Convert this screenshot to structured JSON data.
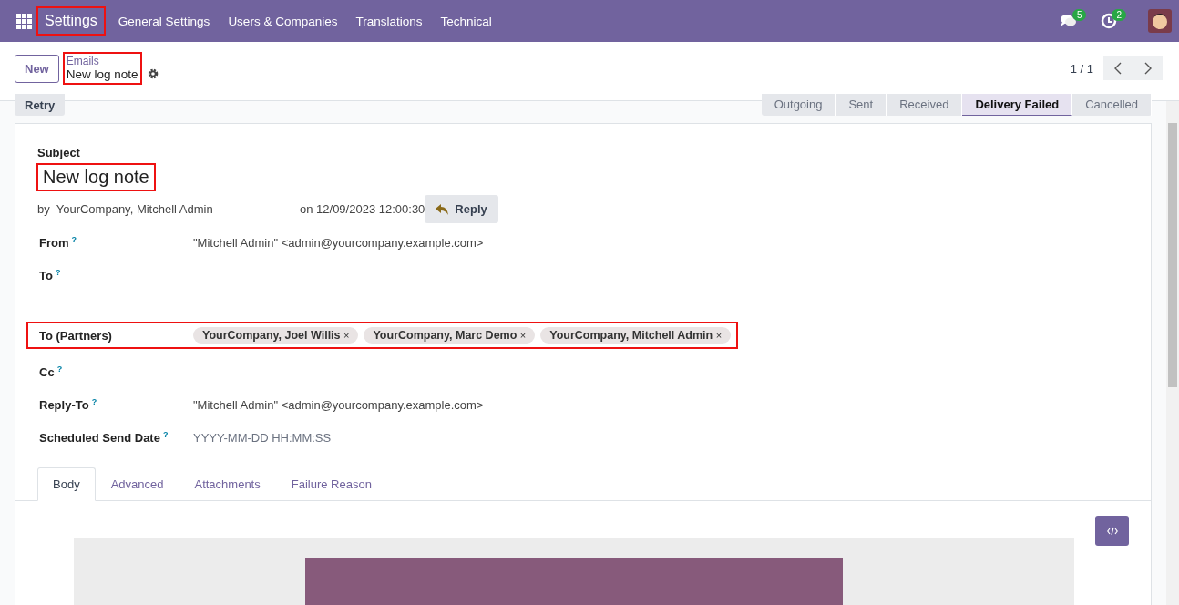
{
  "navbar": {
    "brand": "Settings",
    "brand_highlighted": true,
    "menu": [
      "General Settings",
      "Users & Companies",
      "Translations",
      "Technical"
    ],
    "messages_badge": "5",
    "activities_badge": "2"
  },
  "control_panel": {
    "new_button": "New",
    "breadcrumb_parent": "Emails",
    "breadcrumb_current": "New log note",
    "breadcrumb_highlighted": true,
    "pager": "1 / 1"
  },
  "action_button": "Retry",
  "statusbar": [
    {
      "label": "Outgoing",
      "selected": false
    },
    {
      "label": "Sent",
      "selected": false
    },
    {
      "label": "Received",
      "selected": false
    },
    {
      "label": "Delivery Failed",
      "selected": true
    },
    {
      "label": "Cancelled",
      "selected": false
    }
  ],
  "form": {
    "subject_label": "Subject",
    "subject": "New log note",
    "subject_highlighted": true,
    "author": "by  YourCompany, Mitchell Admin",
    "date": "on 12/09/2023 12:00:30",
    "reply_button": "Reply",
    "fields": [
      {
        "label": "From",
        "help": "?",
        "value": "\"Mitchell Admin\" <admin@yourcompany.example.com>",
        "kind": "text",
        "highlighted": false
      },
      {
        "label": "To",
        "help": "?",
        "kind": "text",
        "highlighted": false
      },
      {
        "label": "To (Partners)",
        "kind": "tags",
        "highlighted": true,
        "tags": [
          {
            "name": "YourCompany, Joel Willis",
            "remove": "×"
          },
          {
            "name": "YourCompany, Marc Demo",
            "remove": "×"
          },
          {
            "name": "YourCompany, Mitchell Admin",
            "remove": "×"
          }
        ]
      },
      {
        "label": "Cc",
        "help": "?",
        "kind": "text",
        "highlighted": false
      },
      {
        "label": "Reply-To",
        "help": "?",
        "value": "\"Mitchell Admin\" <admin@yourcompany.example.com>",
        "kind": "text",
        "highlighted": false
      },
      {
        "label": "Scheduled Send Date",
        "help": "?",
        "placeholder": "YYYY-MM-DD HH:MM:SS",
        "kind": "input",
        "highlighted": false
      }
    ],
    "tabs": [
      {
        "label": "Body",
        "selected": true
      },
      {
        "label": "Advanced",
        "selected": false
      },
      {
        "label": "Attachments",
        "selected": false
      },
      {
        "label": "Failure Reason",
        "selected": false
      }
    ]
  }
}
